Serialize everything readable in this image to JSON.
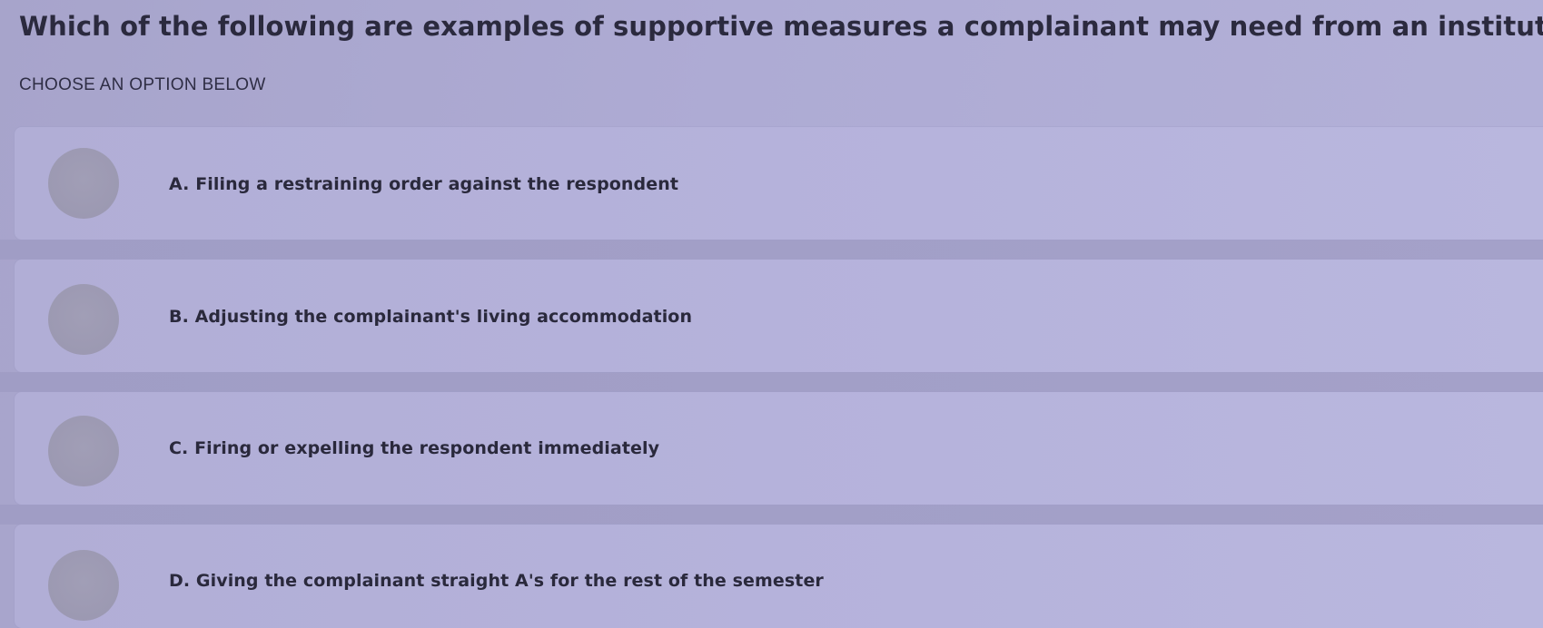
{
  "question": {
    "text": "Which of the following are examples of supportive measures a complainant may need from an institution?",
    "instruction": "CHOOSE AN OPTION BELOW"
  },
  "options": [
    {
      "label": "A. Filing a restraining order against the respondent",
      "selected": false
    },
    {
      "label": "B. Adjusting the complainant's living accommodation",
      "selected": false
    },
    {
      "label": "C. Firing or expelling the respondent immediately",
      "selected": false
    },
    {
      "label": "D. Giving the complainant straight A's for the rest of the semester",
      "selected": false
    }
  ]
}
